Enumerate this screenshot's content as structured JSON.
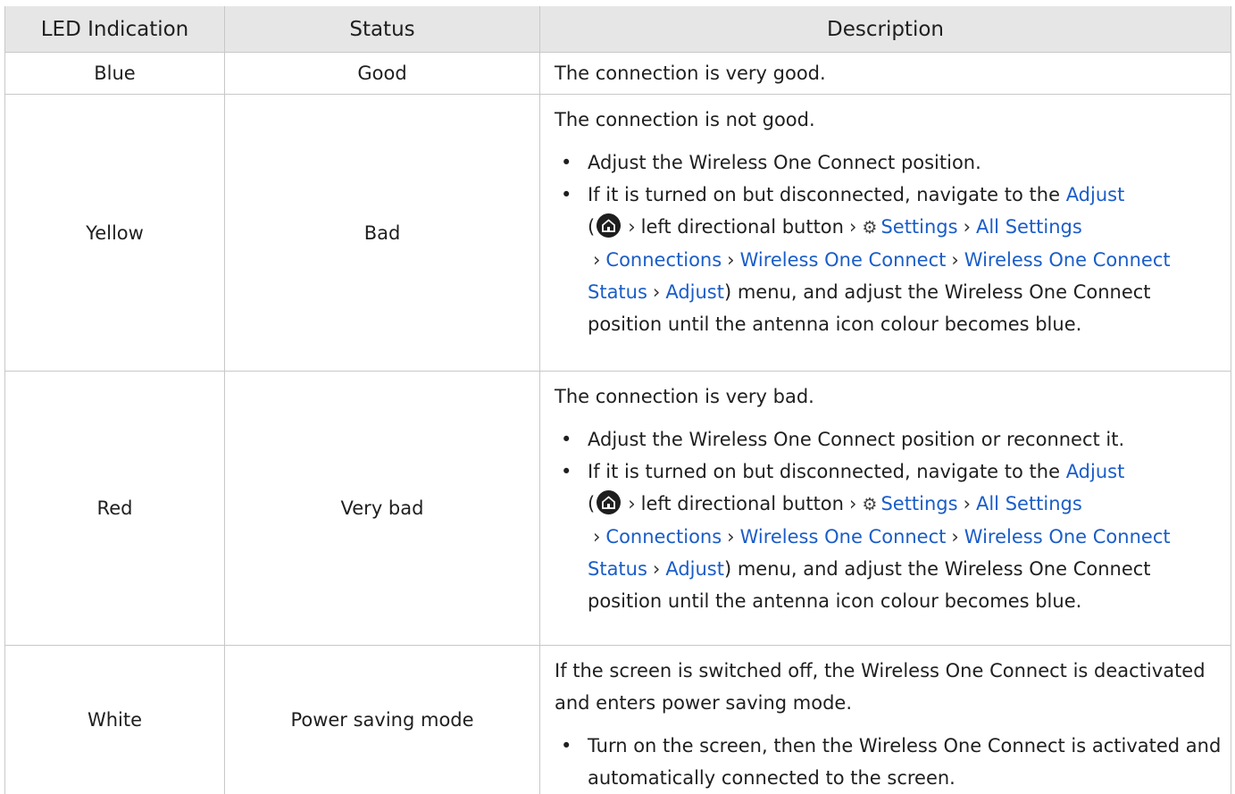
{
  "headers": {
    "led": "LED Indication",
    "status": "Status",
    "description": "Description"
  },
  "rows": [
    {
      "led": "Blue",
      "status": "Good",
      "lead": "The connection is very good."
    },
    {
      "led": "Yellow",
      "status": "Bad",
      "lead": "The connection is not good.",
      "bullet1": "Adjust the Wireless One Connect position."
    },
    {
      "led": "Red",
      "status": "Very bad",
      "lead": "The connection is very bad.",
      "bullet1": "Adjust the Wireless One Connect position or reconnect it."
    },
    {
      "led": "White",
      "status": "Power saving mode",
      "lead": "If the screen is switched off, the Wireless One Connect is deactivated and enters power saving mode.",
      "bullet1": "Turn on the screen, then the Wireless One Connect is activated and automatically connected to the screen."
    }
  ],
  "nav_instruction": {
    "intro": "If it is turned on but disconnected, navigate to the",
    "adjust": "Adjust",
    "open_paren": "(",
    "home_icon": "home-icon",
    "left_dir": "left directional button",
    "gear_icon": "gear-icon",
    "settings": "Settings",
    "all_settings": "All Settings",
    "connections": "Connections",
    "wireless_one_connect": "Wireless One Connect",
    "wireless_one_connect_status": "Wireless One Connect Status",
    "adjust_end": "Adjust",
    "outro": ") menu, and adjust the Wireless One Connect position until the antenna icon colour becomes blue.",
    "chevron": "›",
    "bullet_char": "•",
    "link_color": "#1a5dc8"
  }
}
